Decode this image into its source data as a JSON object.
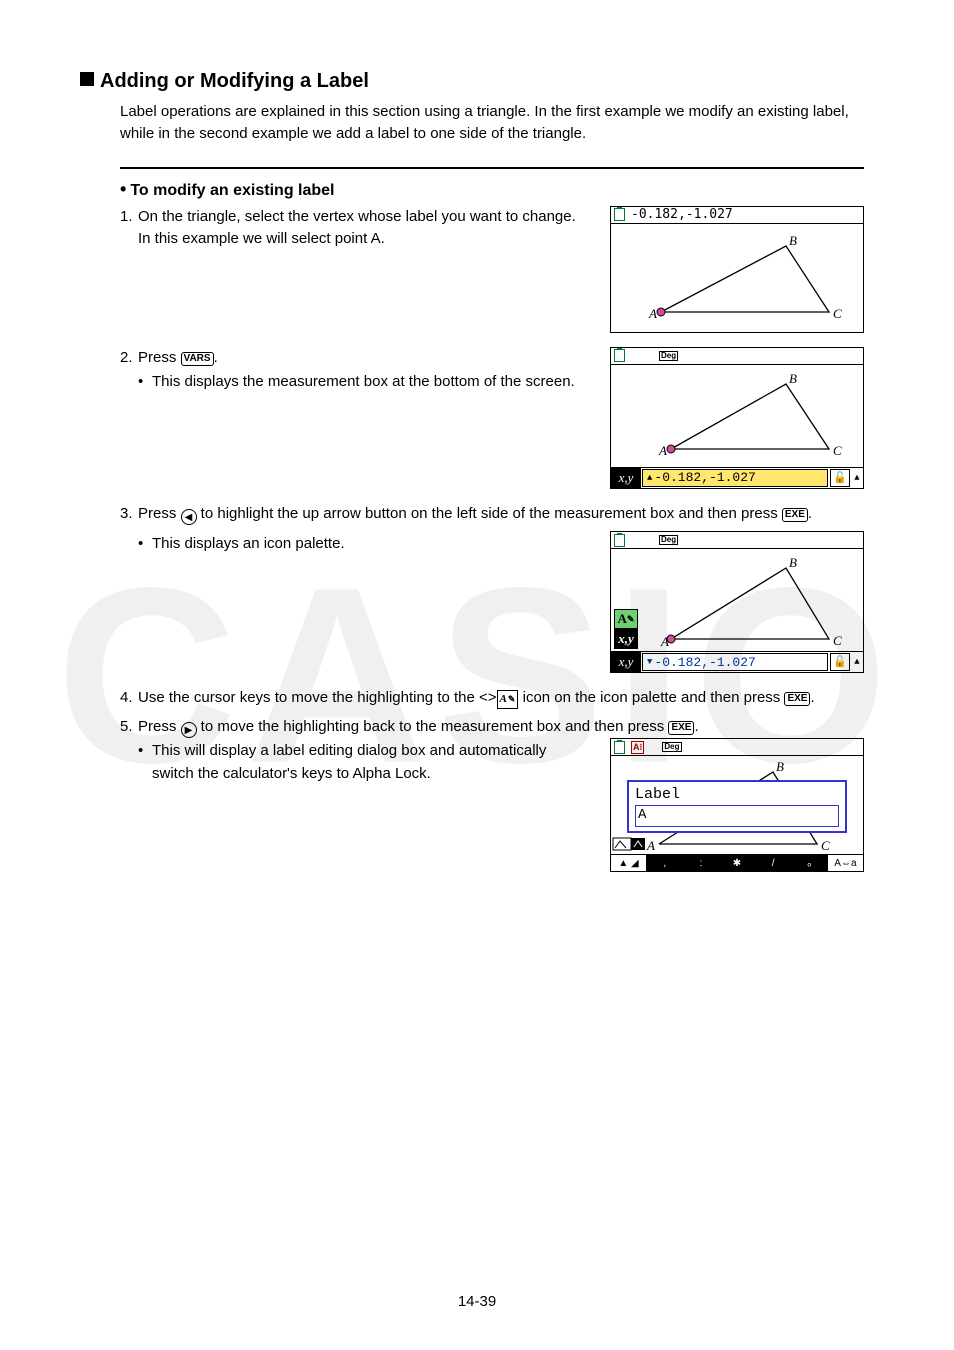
{
  "watermark": "CASIO",
  "section": {
    "heading": "Adding or Modifying a Label"
  },
  "intro": "Label operations are explained in this section using a triangle. In the first example we modify an existing label, while in the second example we add a label to one side of the triangle.",
  "subhead": "To modify an existing label",
  "steps": {
    "s1": {
      "num": "1.",
      "text": "On the triangle, select the vertex whose label you want to change. In this example we will select point A."
    },
    "s2": {
      "num": "2.",
      "text_a": "Press ",
      "text_b": ".",
      "key": "VARS",
      "bullet": "This displays the measurement box at the bottom of the screen."
    },
    "s3": {
      "num": "3.",
      "text_a": "Press ",
      "text_b": " to highlight the up arrow button on the left side of the measurement box and then press ",
      "text_c": ".",
      "key": "EXE",
      "bullet": "This displays an icon palette."
    },
    "s4": {
      "num": "4.",
      "text_a": "Use the cursor keys to move the highlighting to the ",
      "text_b": " icon on the icon palette and then press ",
      "text_c": ".",
      "key": "EXE"
    },
    "s5": {
      "num": "5.",
      "text_a": "Press ",
      "text_b": " to move the highlighting back to the measurement box and then press ",
      "text_c": ".",
      "key": "EXE",
      "bullet": "This will display a label editing dialog box and automatically switch the calculator's keys to Alpha Lock."
    }
  },
  "calc": {
    "coords_plain": "-0.182,-1.027",
    "coords_blue": "-0.182,-1.027",
    "deg": "Deg",
    "xy": "x,y",
    "palette_A": "A",
    "dialog_title": "Label",
    "dialog_value": "A",
    "vertices": {
      "A": "A",
      "B": "B",
      "C": "C"
    },
    "fkeys": [
      "▲ ◢",
      ",",
      ":",
      "✱",
      "/",
      "ₒ",
      "A⇔a"
    ]
  },
  "pageNumber": "14-39"
}
